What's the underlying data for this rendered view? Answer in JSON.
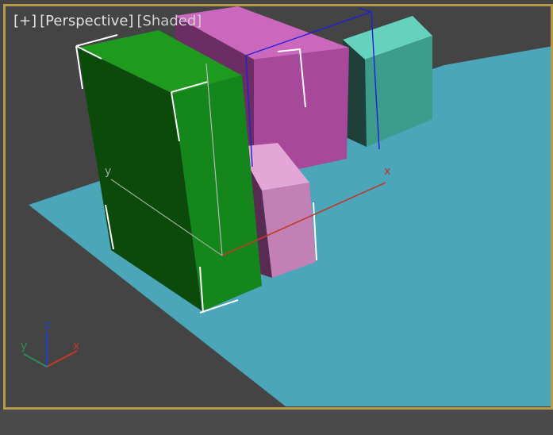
{
  "viewport": {
    "labels": {
      "plus": "[+]",
      "view": "[Perspective]",
      "shading": "[Shaded]"
    },
    "gizmo_axes": {
      "x": "x",
      "y": "y"
    },
    "trihedron": {
      "x": "x",
      "y": "y",
      "z": "z"
    }
  },
  "colors": {
    "background": "#444444",
    "frame_border": "#b69a4b",
    "ground_plane": "#4aa6b8",
    "green_box": "#168a16",
    "magenta_box": "#b04fa3",
    "pink_box": "#c77bb6",
    "teal_box": "#4fbfa9",
    "selection_brackets": "#ffffff",
    "blue_bbox": "#1a1ad0",
    "axis_x": "#c0392b",
    "axis_y": "#2e8b57",
    "axis_z": "#2040d0"
  }
}
